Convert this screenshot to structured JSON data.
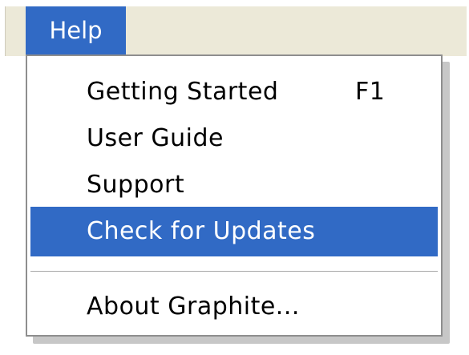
{
  "menubar": {
    "help_label": "Help"
  },
  "help_menu": {
    "items": [
      {
        "label": "Getting Started",
        "shortcut": "F1"
      },
      {
        "label": "User Guide",
        "shortcut": ""
      },
      {
        "label": "Support",
        "shortcut": ""
      },
      {
        "label": "Check for Updates",
        "shortcut": "",
        "highlighted": true
      },
      {
        "label": "About Graphite...",
        "shortcut": ""
      }
    ]
  },
  "colors": {
    "selection": "#316ac5",
    "menubar_bg": "#ece9d8",
    "menu_bg": "#ffffff"
  }
}
